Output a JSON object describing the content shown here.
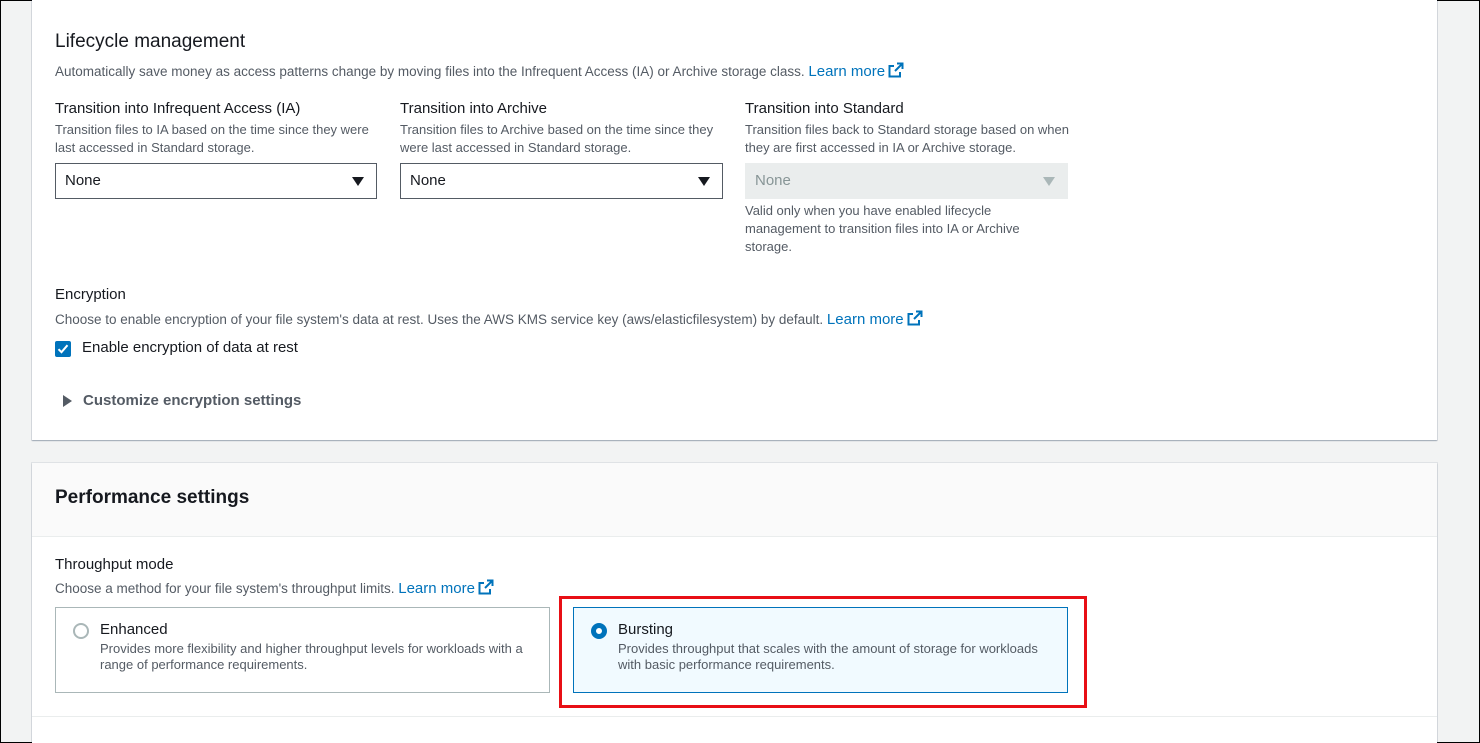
{
  "lifecycle": {
    "title": "Lifecycle management",
    "description": "Automatically save money as access patterns change by moving files into the Infrequent Access (IA) or Archive storage class.",
    "learn_more": "Learn more",
    "columns": [
      {
        "label": "Transition into Infrequent Access (IA)",
        "description": "Transition files to IA based on the time since they were last accessed in Standard storage.",
        "value": "None",
        "disabled": false
      },
      {
        "label": "Transition into Archive",
        "description": "Transition files to Archive based on the time since they were last accessed in Standard storage.",
        "value": "None",
        "disabled": false
      },
      {
        "label": "Transition into Standard",
        "description": "Transition files back to Standard storage based on when they are first accessed in IA or Archive storage.",
        "value": "None",
        "disabled": true,
        "constraint": "Valid only when you have enabled lifecycle management to transition files into IA or Archive storage."
      }
    ]
  },
  "encryption": {
    "title": "Encryption",
    "description": "Choose to enable encryption of your file system's data at rest. Uses the AWS KMS service key (aws/elasticfilesystem) by default.",
    "learn_more": "Learn more",
    "checkbox_label": "Enable encryption of data at rest",
    "checked": true,
    "customize_label": "Customize encryption settings"
  },
  "performance": {
    "title": "Performance settings",
    "throughput": {
      "label": "Throughput mode",
      "description": "Choose a method for your file system's throughput limits.",
      "learn_more": "Learn more",
      "options": [
        {
          "title": "Enhanced",
          "description": "Provides more flexibility and higher throughput levels for workloads with a range of performance requirements.",
          "selected": false
        },
        {
          "title": "Bursting",
          "description": "Provides throughput that scales with the amount of storage for workloads with basic performance requirements.",
          "selected": true
        }
      ]
    }
  },
  "colors": {
    "accent": "#0073bb",
    "highlight": "#e80f15"
  },
  "icons": [
    "external-link-icon",
    "caret-down-icon",
    "checkmark-icon",
    "expand-triangle-icon",
    "radio-icon"
  ]
}
